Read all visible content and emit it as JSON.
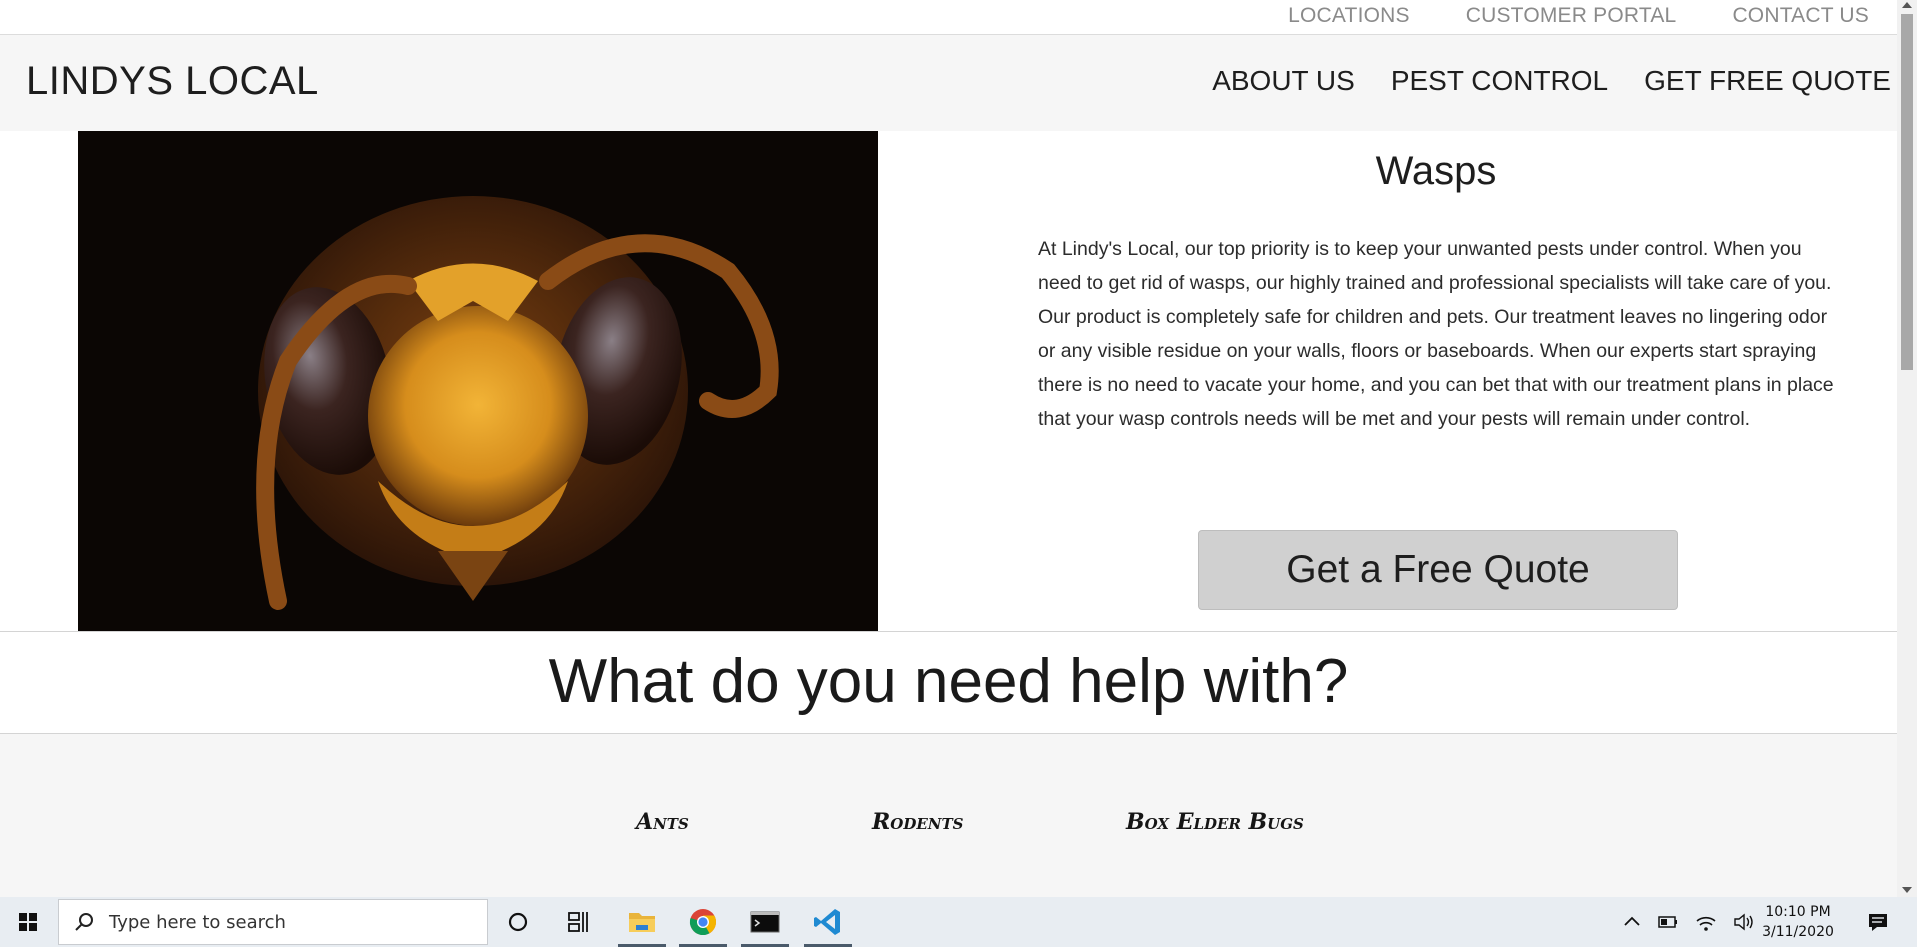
{
  "topbar": {
    "links": [
      "LOCATIONS",
      "CUSTOMER PORTAL",
      "CONTACT US"
    ]
  },
  "header": {
    "logo": "LINDYS LOCAL",
    "nav": [
      "ABOUT US",
      "PEST CONTROL",
      "GET FREE QUOTE"
    ]
  },
  "hero": {
    "title": "Wasps",
    "body": "At Lindy's Local, our top priority is to keep your unwanted pests under control. When you need to get rid of wasps, our highly trained and professional specialists will take care of you. Our product is completely safe for children and pets. Our treatment leaves no lingering odor or any visible residue on your walls, floors or baseboards. When our experts start spraying there is no need to vacate your home, and you can bet that with our treatment plans in place that your wasp controls needs will be met and your pests will remain under control.",
    "cta": "Get a Free Quote"
  },
  "help": {
    "heading": "What do you need help with?",
    "categories": [
      "Ants",
      "Rodents",
      "Box Elder Bugs"
    ]
  },
  "taskbar": {
    "search_placeholder": "Type here to search",
    "time": "10:10 PM",
    "date": "3/11/2020",
    "pinned": [
      "file-explorer-icon",
      "chrome-icon",
      "terminal-icon",
      "vscode-icon"
    ]
  }
}
